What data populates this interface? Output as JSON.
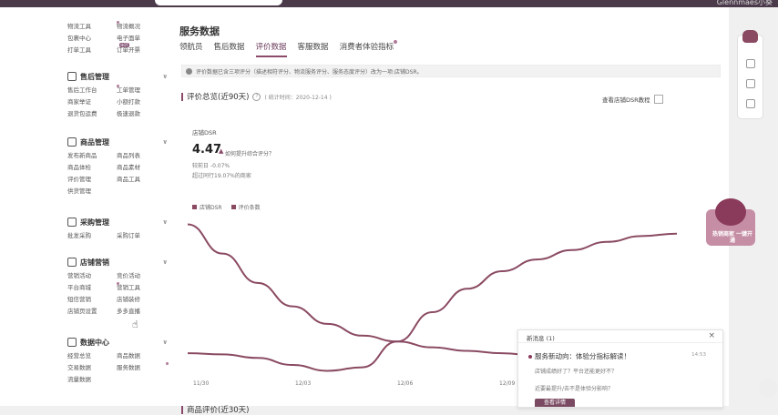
{
  "topbar": {
    "user": "Glennmaes小葵"
  },
  "sidebar": {
    "groups": [
      {
        "title": "",
        "items": [
          {
            "label": "物流工具",
            "dot": true
          },
          {
            "label": "物流概况",
            "dot": false
          },
          {
            "label": "包裹中心",
            "dot": false
          },
          {
            "label": "电子面单",
            "dot": false
          },
          {
            "label": "打单工具",
            "hot": true
          },
          {
            "label": "订单开票",
            "dot": false
          }
        ]
      },
      {
        "title": "售后管理",
        "items": [
          {
            "label": "售后工作台",
            "dot": true
          },
          {
            "label": "工单管理",
            "dot": false
          },
          {
            "label": "商家举证",
            "dot": false
          },
          {
            "label": "小额打款",
            "dot": false
          },
          {
            "label": "退货包运费",
            "dot": false
          },
          {
            "label": "极速退款",
            "dot": false
          }
        ]
      },
      {
        "title": "商品管理",
        "items": [
          {
            "label": "发布新商品",
            "dot": false
          },
          {
            "label": "商品列表",
            "dot": false
          },
          {
            "label": "商品体检",
            "dot": false
          },
          {
            "label": "商品素材",
            "dot": false
          },
          {
            "label": "评价管理",
            "dot": false
          },
          {
            "label": "商品工具",
            "dot": false
          },
          {
            "label": "供货管理",
            "dot": false
          }
        ]
      },
      {
        "title": "采购管理",
        "items": [
          {
            "label": "批发采购",
            "dot": false
          },
          {
            "label": "采购订单",
            "dot": false
          }
        ]
      },
      {
        "title": "店铺营销",
        "items": [
          {
            "label": "营销活动",
            "dot": false
          },
          {
            "label": "竞价活动",
            "dot": false
          },
          {
            "label": "平台商城",
            "dot": true
          },
          {
            "label": "营销工具",
            "dot": false
          },
          {
            "label": "短信营销",
            "dot": false
          },
          {
            "label": "店铺装修",
            "dot": false
          },
          {
            "label": "店铺页设置",
            "dot": false
          },
          {
            "label": "多多直播",
            "dot": false
          }
        ]
      },
      {
        "title": "数据中心",
        "items": [
          {
            "label": "经营总览",
            "dot": false
          },
          {
            "label": "商品数据",
            "dot": false
          },
          {
            "label": "交易数据",
            "dot": false
          },
          {
            "label": "服务数据",
            "dot": true
          },
          {
            "label": "流量数据",
            "dot": false
          }
        ]
      }
    ]
  },
  "main": {
    "title": "服务数据",
    "tabs": [
      {
        "label": "领航员",
        "active": false,
        "dot": false
      },
      {
        "label": "售后数据",
        "active": false,
        "dot": false
      },
      {
        "label": "评价数据",
        "active": true,
        "dot": false
      },
      {
        "label": "客服数据",
        "active": false,
        "dot": false
      },
      {
        "label": "消费者体验指标",
        "active": false,
        "dot": true
      }
    ],
    "notice": "评价数据已含三项评分（描述相符评分、物流服务评分、服务态度评分）改为一项:店铺DSR。",
    "section": {
      "title": "评价总览(近90天)",
      "stat": "( 统计时间：2020-12-14 )",
      "link": "查看店铺DSR教程"
    },
    "dsr": {
      "label": "店铺DSR",
      "value": "4.47",
      "hint": "如何提升综合评分？",
      "compare": "较前日 -0.07%",
      "beat": "超过同行19.07%的商家"
    },
    "next_section": "商品评价(近30天)"
  },
  "chart_data": {
    "type": "line",
    "x": [
      "11/30",
      "12/03",
      "12/06",
      "12/09"
    ],
    "series": [
      {
        "name": "店铺DSR",
        "color": "#8a4a62",
        "values": [
          4.8,
          4.55,
          4.3,
          4.1,
          3.95,
          3.85,
          3.8,
          3.75,
          3.72,
          3.7,
          3.68,
          3.66,
          3.65,
          3.64,
          3.63
        ]
      },
      {
        "name": "评价条数",
        "color": "#8a4a62",
        "values": [
          3.7,
          3.69,
          3.66,
          3.6,
          3.55,
          3.58,
          3.8,
          4.05,
          4.25,
          4.4,
          4.5,
          4.58,
          4.65,
          4.7,
          4.72
        ]
      }
    ],
    "legend": "top-left"
  },
  "popup": {
    "header": "新消息 (1)",
    "title": "服务新动向：体验分指标解读！",
    "time": "14:53",
    "sub1": "店铺成绩好了？平台还能更好不？",
    "sub2": "近要最提升/去不是体验分影响？",
    "button": "查看详情"
  },
  "promo": {
    "text": "热销商家 一键开通"
  }
}
